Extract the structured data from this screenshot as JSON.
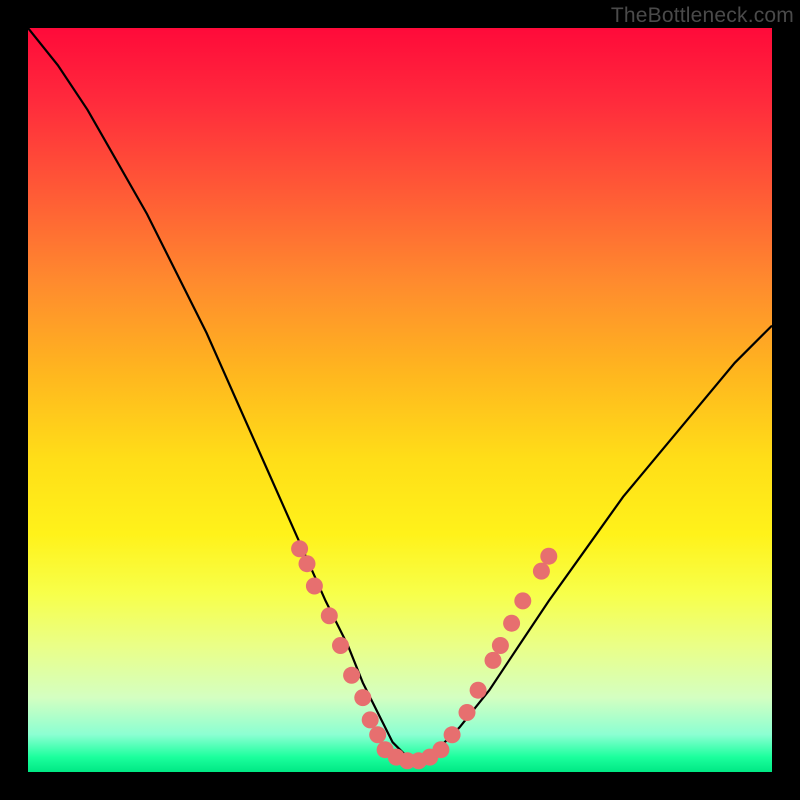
{
  "attribution": "TheBottleneck.com",
  "chart_data": {
    "type": "line",
    "title": "",
    "xlabel": "",
    "ylabel": "",
    "xlim": [
      0,
      100
    ],
    "ylim": [
      0,
      100
    ],
    "grid": false,
    "x": [
      0,
      4,
      8,
      12,
      16,
      20,
      24,
      28,
      32,
      36,
      40,
      43,
      45,
      47,
      49,
      51,
      53,
      55,
      58,
      62,
      66,
      70,
      75,
      80,
      85,
      90,
      95,
      100
    ],
    "values": [
      100,
      95,
      89,
      82,
      75,
      67,
      59,
      50,
      41,
      32,
      23,
      17,
      12,
      8,
      4,
      2,
      2,
      3,
      6,
      11,
      17,
      23,
      30,
      37,
      43,
      49,
      55,
      60
    ],
    "dots_left": [
      {
        "x": 36.5,
        "y": 30
      },
      {
        "x": 37.5,
        "y": 28
      },
      {
        "x": 38.5,
        "y": 25
      },
      {
        "x": 40.5,
        "y": 21
      },
      {
        "x": 42.0,
        "y": 17
      },
      {
        "x": 43.5,
        "y": 13
      },
      {
        "x": 45.0,
        "y": 10
      },
      {
        "x": 46.0,
        "y": 7
      },
      {
        "x": 47.0,
        "y": 5
      }
    ],
    "dots_bottom": [
      {
        "x": 48.0,
        "y": 3
      },
      {
        "x": 49.5,
        "y": 2
      },
      {
        "x": 51.0,
        "y": 1.5
      },
      {
        "x": 52.5,
        "y": 1.5
      },
      {
        "x": 54.0,
        "y": 2
      },
      {
        "x": 55.5,
        "y": 3
      }
    ],
    "dots_right": [
      {
        "x": 57.0,
        "y": 5
      },
      {
        "x": 59.0,
        "y": 8
      },
      {
        "x": 60.5,
        "y": 11
      },
      {
        "x": 62.5,
        "y": 15
      },
      {
        "x": 63.5,
        "y": 17
      },
      {
        "x": 65.0,
        "y": 20
      },
      {
        "x": 66.5,
        "y": 23
      },
      {
        "x": 69.0,
        "y": 27
      },
      {
        "x": 70.0,
        "y": 29
      }
    ],
    "dot_color": "#e76f6f",
    "curve_color": "#000000"
  }
}
